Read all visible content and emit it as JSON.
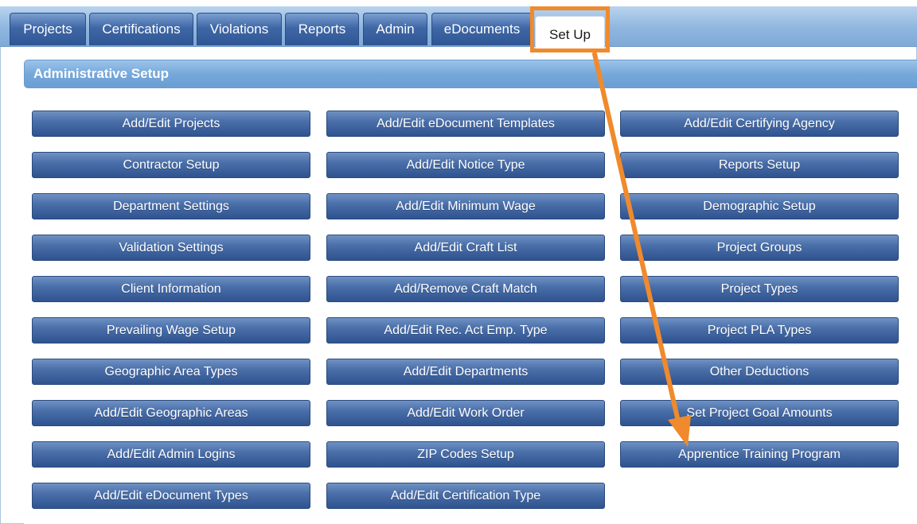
{
  "tabs": [
    {
      "label": "Projects"
    },
    {
      "label": "Certifications"
    },
    {
      "label": "Violations"
    },
    {
      "label": "Reports"
    },
    {
      "label": "Admin"
    },
    {
      "label": "eDocuments"
    },
    {
      "label": "Set Up"
    }
  ],
  "active_tab": "Set Up",
  "section": {
    "title": "Administrative Setup"
  },
  "buttons": {
    "col1": [
      "Add/Edit Projects",
      "Contractor Setup",
      "Department Settings",
      "Validation Settings",
      "Client Information",
      "Prevailing Wage Setup",
      "Geographic Area Types",
      "Add/Edit Geographic Areas",
      "Add/Edit Admin Logins",
      "Add/Edit eDocument Types"
    ],
    "col2": [
      "Add/Edit eDocument Templates",
      "Add/Edit Notice Type",
      "Add/Edit Minimum Wage",
      "Add/Edit Craft List",
      "Add/Remove Craft Match",
      "Add/Edit Rec. Act Emp. Type",
      "Add/Edit Departments",
      "Add/Edit Work Order",
      "ZIP Codes Setup",
      "Add/Edit Certification Type"
    ],
    "col3": [
      "Add/Edit Certifying Agency",
      "Reports Setup",
      "Demographic Setup",
      "Project Groups",
      "Project Types",
      "Project PLA Types",
      "Other Deductions",
      "Set Project Goal Amounts",
      "Apprentice Training Program"
    ]
  },
  "annotation": {
    "color": "#f08a2c"
  }
}
